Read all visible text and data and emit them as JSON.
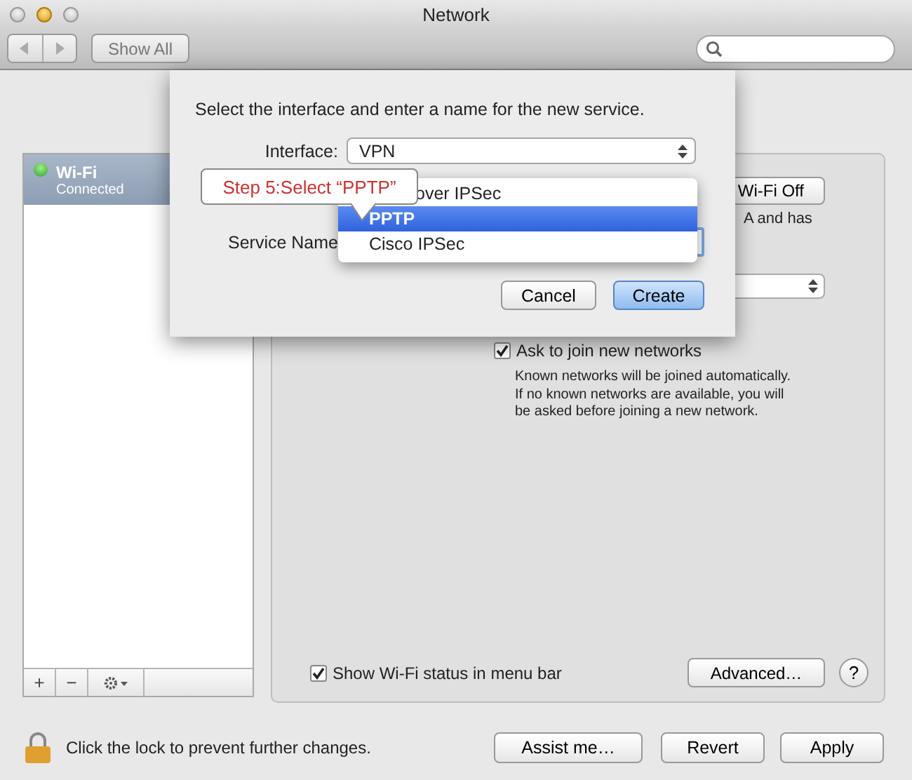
{
  "window": {
    "title": "Network"
  },
  "toolbar": {
    "show_all": "Show All"
  },
  "sidebar": {
    "items": [
      {
        "name": "Wi-Fi",
        "status": "Connected",
        "selected": true
      }
    ],
    "buttons": [
      "+",
      "−"
    ]
  },
  "panel": {
    "turn_off_button": "Wi-Fi Off",
    "status_text": "A and has",
    "ask_to_join": {
      "label": "Ask to join new networks",
      "checked": true
    },
    "ask_to_join_note": "Known networks will be joined automatically.\nIf no known networks are available, you will\nbe asked before joining a new network.",
    "show_status": {
      "label": "Show Wi-Fi status in menu bar",
      "checked": true
    },
    "advanced_button": "Advanced…",
    "help_button": "?"
  },
  "lock": {
    "text": "Click the lock to prevent further changes."
  },
  "buttons": [
    "Assist me…",
    "Revert",
    "Apply"
  ],
  "sheet": {
    "prompt": "Select the interface and enter a name for the new service.",
    "interface": {
      "label": "Interface:",
      "value": "VPN"
    },
    "service_name": {
      "label": "Service Name"
    },
    "buttons": [
      {
        "label": "Cancel",
        "default": false
      },
      {
        "label": "Create",
        "default": true
      }
    ]
  },
  "menu": {
    "items": [
      {
        "label": "over IPSec",
        "selected": false
      },
      {
        "label": "PPTP",
        "selected": true
      },
      {
        "label": "Cisco IPSec",
        "selected": false
      }
    ]
  },
  "callout": "Step 5:Select “PPTP”"
}
